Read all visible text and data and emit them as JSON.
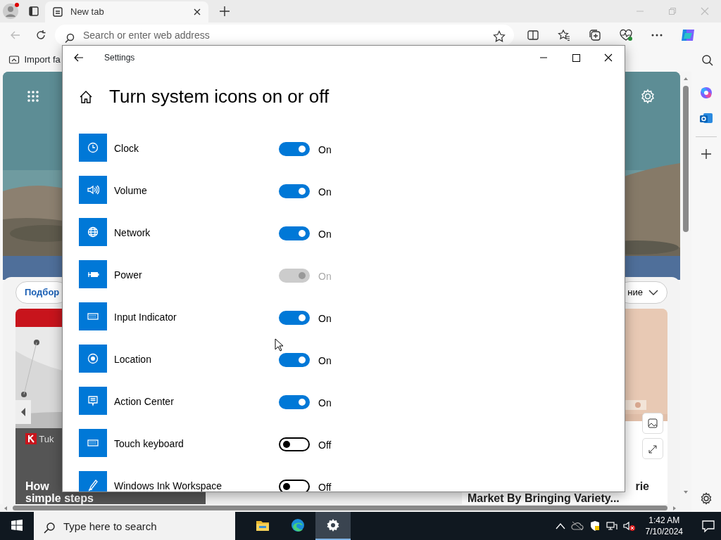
{
  "browser": {
    "tab_title": "New tab",
    "address_placeholder": "Search or enter web address",
    "favorites_item": "Import fa",
    "new_tab_page": {
      "feed_tab": "Подбор",
      "dropdown_label": "ние",
      "left_card": {
        "source": "Tuk",
        "headline_lines": [
          "How",
          "simple steps"
        ]
      },
      "right_card": {
        "headline_lines": [
          "rie",
          "Market By Bringing Variety..."
        ]
      }
    }
  },
  "settings": {
    "window_title": "Settings",
    "heading": "Turn system icons on or off",
    "items": [
      {
        "label": "Clock",
        "on": true,
        "disabled": false,
        "state_text": "On"
      },
      {
        "label": "Volume",
        "on": true,
        "disabled": false,
        "state_text": "On"
      },
      {
        "label": "Network",
        "on": true,
        "disabled": false,
        "state_text": "On"
      },
      {
        "label": "Power",
        "on": true,
        "disabled": true,
        "state_text": "On"
      },
      {
        "label": "Input Indicator",
        "on": true,
        "disabled": false,
        "state_text": "On"
      },
      {
        "label": "Location",
        "on": true,
        "disabled": false,
        "state_text": "On"
      },
      {
        "label": "Action Center",
        "on": true,
        "disabled": false,
        "state_text": "On"
      },
      {
        "label": "Touch keyboard",
        "on": false,
        "disabled": false,
        "state_text": "Off"
      },
      {
        "label": "Windows Ink Workspace",
        "on": false,
        "disabled": false,
        "state_text": "Off"
      }
    ]
  },
  "taskbar": {
    "search_placeholder": "Type here to search",
    "apps": [
      {
        "selected": false
      },
      {
        "selected": false
      },
      {
        "selected": true
      }
    ],
    "time": "1:42 AM",
    "date": "7/10/2024"
  }
}
